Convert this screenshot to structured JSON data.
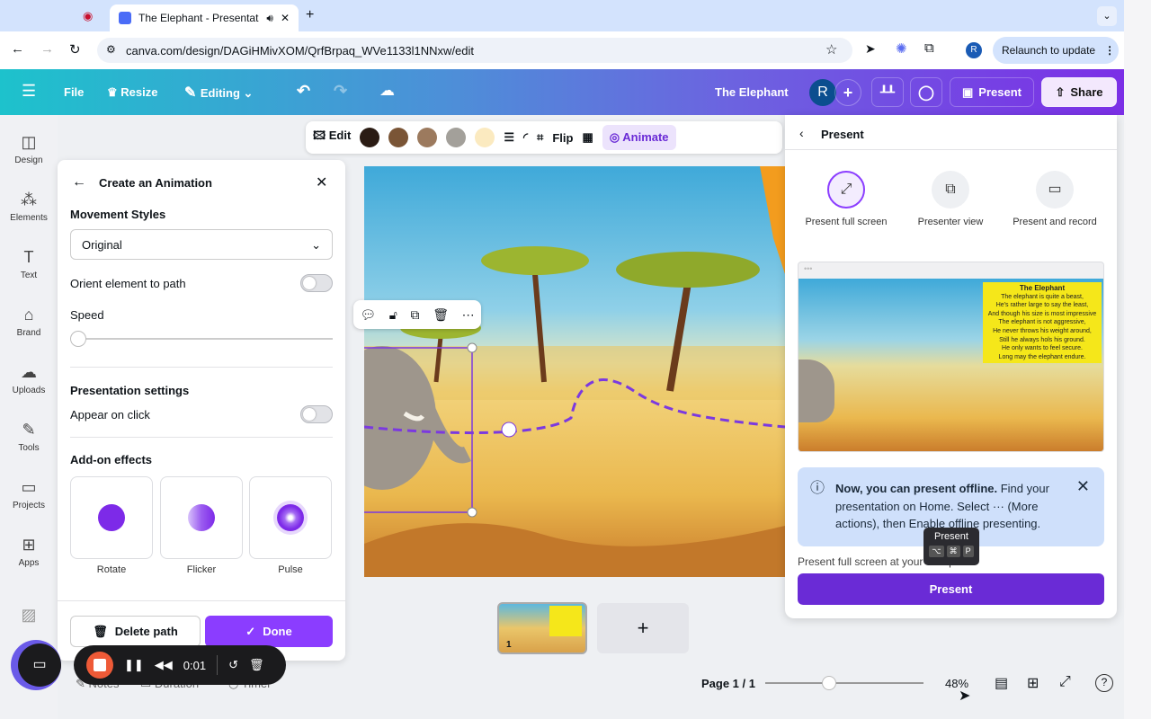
{
  "browser": {
    "tab_title": "The Elephant - Presentation",
    "url": "canva.com/design/DAGiHMivXOM/QrfBrpaq_WVe1133l1NNxw/edit",
    "relaunch": "Relaunch to update",
    "profile": "R"
  },
  "header": {
    "file": "File",
    "resize": "Resize",
    "editing": "Editing",
    "title": "The Elephant",
    "avatar": "R",
    "present": "Present",
    "share": "Share"
  },
  "sidebar": {
    "items": [
      {
        "label": "Design"
      },
      {
        "label": "Elements"
      },
      {
        "label": "Text"
      },
      {
        "label": "Brand"
      },
      {
        "label": "Uploads"
      },
      {
        "label": "Tools"
      },
      {
        "label": "Projects"
      },
      {
        "label": "Apps"
      }
    ]
  },
  "toolbar": {
    "edit": "Edit",
    "flip": "Flip",
    "animate": "Animate",
    "colors": [
      "#2b1c14",
      "#7a5536",
      "#9c7a5e",
      "#a3a09a",
      "#fbeac0"
    ]
  },
  "animation_panel": {
    "title": "Create an Animation",
    "movement_styles": "Movement Styles",
    "style_value": "Original",
    "orient": "Orient element to path",
    "speed": "Speed",
    "speed_value": 0,
    "presentation_settings": "Presentation settings",
    "appear_on_click": "Appear on click",
    "addon_effects": "Add-on effects",
    "effects": [
      "Rotate",
      "Flicker",
      "Pulse"
    ],
    "delete_path": "Delete path",
    "done": "Done"
  },
  "present_panel": {
    "title": "Present",
    "options": [
      "Present full screen",
      "Presenter view",
      "Present and record"
    ],
    "preview_title": "The Elephant",
    "poem": [
      "The elephant is quite a beast,",
      "He's rather large to say the least,",
      "And though his size is most impressive",
      "The elephant is not aggressive,",
      "He never throws his weight around,",
      "Still he always hols his ground.",
      "He only wants to feel secure.",
      "Long may the elephant endure."
    ],
    "info_bold": "Now, you can present offline.",
    "info_text": " Find your presentation on Home. Select ··· (More actions), then Enable offline presenting.",
    "sub": "Present full screen at your own pace",
    "button": "Present",
    "tooltip": "Present",
    "shortcut": [
      "⌥",
      "⌘",
      "P"
    ]
  },
  "recorder": {
    "time": "0:01"
  },
  "pages": {
    "thumb_number": "1",
    "add": "+"
  },
  "bottom": {
    "notes": "Notes",
    "duration": "Duration",
    "timer": "Timer",
    "page": "Page 1 / 1",
    "zoom": "48%",
    "zoom_value": 48,
    "help": "?"
  }
}
